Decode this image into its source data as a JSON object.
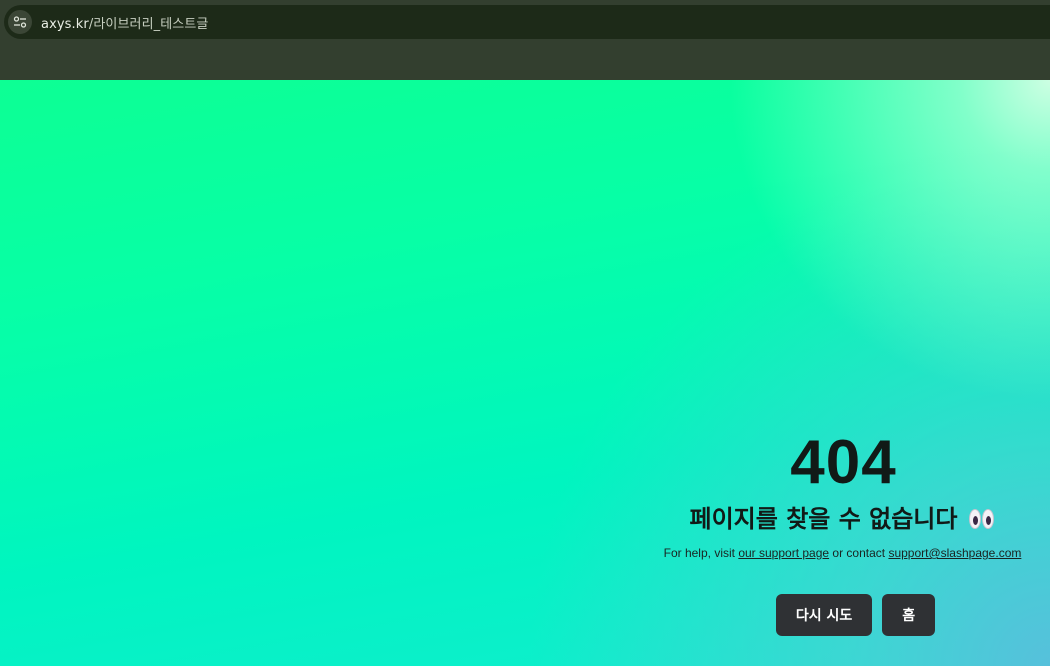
{
  "browser": {
    "url_host": "axys.kr",
    "url_path": "/라이브러리_테스트글",
    "icons": {
      "site_info": "tune-icon"
    }
  },
  "error": {
    "code": "404",
    "title": "페이지를 찾을 수 없습니다",
    "title_emoji": "eyes-icon",
    "help_prefix": "For help, visit ",
    "support_link": "our support page",
    "help_middle": " or contact ",
    "email_link": "support@slashpage.com"
  },
  "actions": {
    "retry_label": "다시 시도",
    "home_label": "홈"
  },
  "colors": {
    "chrome": "#333f2f",
    "address_bar": "#1d2a18",
    "gradient_top": "#0dff94",
    "gradient_bottom": "#12ecd0",
    "button_bg": "#2f3134",
    "text": "#111a17"
  }
}
